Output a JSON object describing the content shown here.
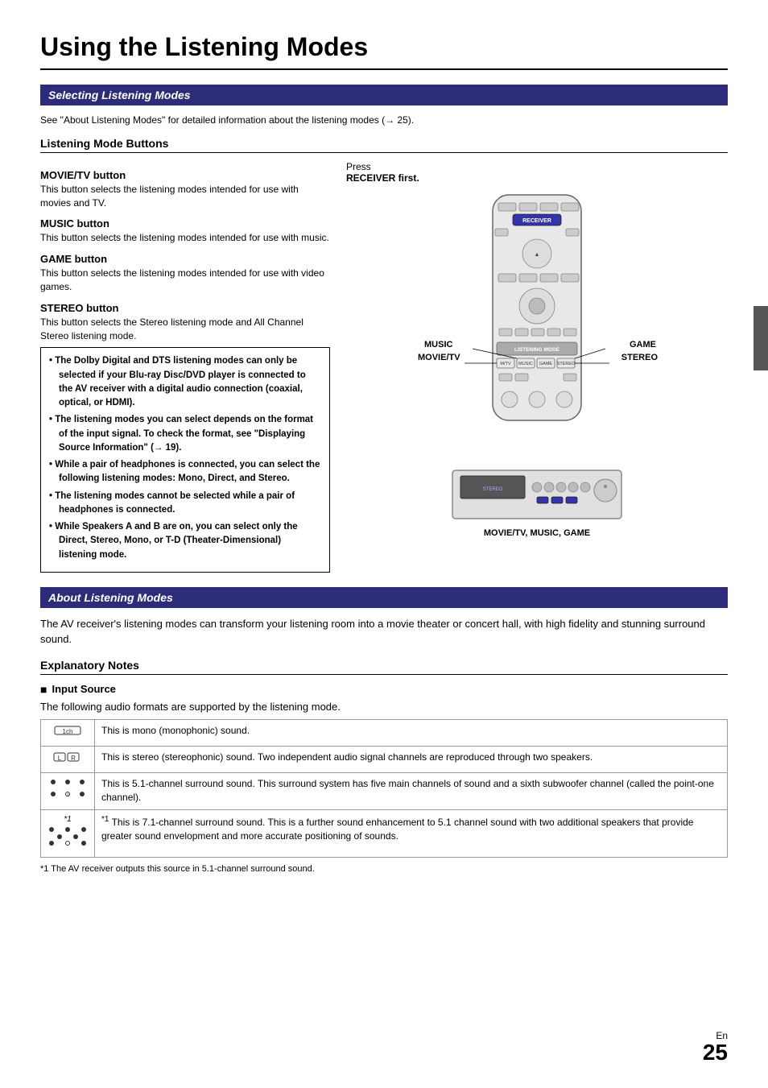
{
  "page": {
    "title": "Using the Listening Modes",
    "number": "25",
    "lang": "En"
  },
  "section1": {
    "header": "Selecting Listening Modes",
    "intro": "See \"About Listening Modes\" for detailed information about the listening modes (→ 25).",
    "subsection": "Listening Mode Buttons",
    "buttons": [
      {
        "label": "MOVIE/TV button",
        "desc": "This button selects the listening modes intended for use with movies and TV."
      },
      {
        "label": "MUSIC button",
        "desc": "This button selects the listening modes intended for use with music."
      },
      {
        "label": "GAME button",
        "desc": "This button selects the listening modes intended for use with video games."
      },
      {
        "label": "STEREO button",
        "desc": "This button selects the Stereo listening mode and All Channel Stereo listening mode."
      }
    ],
    "notes": [
      "The Dolby Digital and DTS listening modes can only be selected if your Blu-ray Disc/DVD player is connected to the AV receiver with a digital audio connection (coaxial, optical, or HDMI).",
      "The listening modes you can select depends on the format of the input signal. To check the format, see \"Displaying Source Information\" (→ 19).",
      "While a pair of headphones is connected, you can select the following listening modes: Mono, Direct, and Stereo.",
      "The listening modes cannot be selected while a pair of headphones is connected.",
      "While Speakers A and B are on, you can select only the Direct, Stereo, Mono, or T-D (Theater-Dimensional) listening mode."
    ],
    "diagram": {
      "press_text": "Press",
      "receiver_first": "RECEIVER first.",
      "labels": {
        "music": "MUSIC",
        "movie_tv": "MOVIE/TV",
        "game": "GAME",
        "stereo": "STEREO",
        "receiver_modes": "MOVIE/TV, MUSIC, GAME"
      }
    }
  },
  "section2": {
    "header": "About Listening Modes",
    "desc": "The AV receiver's listening modes can transform your listening room into a movie theater or concert hall, with high fidelity and stunning surround sound.",
    "explanatory_notes": "Explanatory Notes",
    "input_source": {
      "header": "Input Source",
      "desc": "The following audio formats are supported by the listening mode.",
      "rows": [
        {
          "icon": "",
          "text": "This is mono (monophonic) sound."
        },
        {
          "icon": "",
          "text": "This is stereo (stereophonic) sound. Two independent audio signal channels are reproduced through two speakers."
        },
        {
          "icon": "",
          "text": "This is 5.1-channel surround sound. This surround system has five main channels of sound and a sixth subwoofer channel (called the point-one channel)."
        },
        {
          "icon": "*1",
          "text": "This is 7.1-channel surround sound. This is a further sound enhancement to 5.1 channel sound with two additional speakers that provide greater sound envelopment and more accurate positioning of sounds."
        }
      ],
      "footnote": "*1   The AV receiver outputs this source in 5.1-channel surround sound."
    }
  }
}
